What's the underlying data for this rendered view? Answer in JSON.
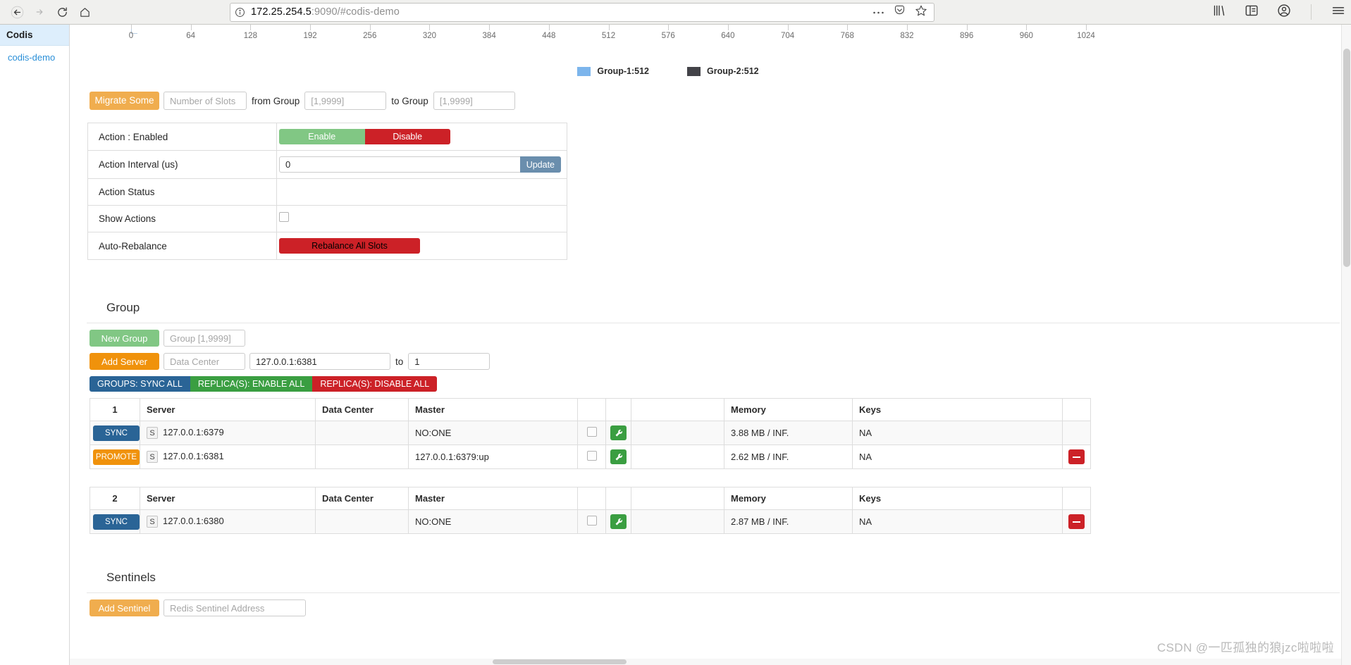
{
  "browser": {
    "back_icon": "back-arrow-icon",
    "forward_icon": "forward-arrow-icon",
    "reload_icon": "reload-icon",
    "home_icon": "home-icon",
    "info_icon": "page-info-icon",
    "url_host": "172.25.254.5",
    "url_rest": ":9090/#codis-demo",
    "url_full": "172.25.254.5:9090/#codis-demo",
    "more_icon": "ellipsis-icon",
    "pocket_icon": "pocket-icon",
    "bookmark_icon": "star-icon",
    "library_icon": "library-icon",
    "sidebar_icon": "sidebar-toggle-icon",
    "account_icon": "account-icon",
    "menu_icon": "hamburger-menu-icon"
  },
  "sidebar": {
    "header": "Codis",
    "items": [
      {
        "label": "codis-demo"
      }
    ]
  },
  "chart_data": {
    "type": "bar",
    "title": "",
    "xlabel": "",
    "ylabel": "",
    "orientation": "horizontal-stacked",
    "xlim": [
      0,
      1024
    ],
    "tick_labels": [
      "0",
      "64",
      "128",
      "192",
      "256",
      "320",
      "384",
      "448",
      "512",
      "576",
      "640",
      "704",
      "768",
      "832",
      "896",
      "960",
      "1024"
    ],
    "tick_values": [
      0,
      64,
      128,
      192,
      256,
      320,
      384,
      448,
      512,
      576,
      640,
      704,
      768,
      832,
      896,
      960,
      1024
    ],
    "grid": false,
    "legend_position": "bottom-center",
    "series": [
      {
        "name": "Group-1:512",
        "value": 512,
        "color": "#7cb5ec"
      },
      {
        "name": "Group-2:512",
        "value": 512,
        "color": "#434348"
      }
    ]
  },
  "migrate": {
    "button_label": "Migrate Some",
    "slots_placeholder": "Number of Slots",
    "slots_value": "",
    "from_label": "from Group",
    "from_placeholder": "[1,9999]",
    "from_value": "",
    "to_label": "to Group",
    "to_placeholder": "[1,9999]",
    "to_value": ""
  },
  "action_table": {
    "rows": [
      {
        "label": "Action : Enabled",
        "type": "segmented",
        "enable_label": "Enable",
        "disable_label": "Disable"
      },
      {
        "label": "Action Interval (us)",
        "type": "input-addon",
        "value": "0",
        "addon_label": "Update"
      },
      {
        "label": "Action Status",
        "type": "empty",
        "value": ""
      },
      {
        "label": "Show Actions",
        "type": "checkbox",
        "checked": false
      },
      {
        "label": "Auto-Rebalance",
        "type": "button",
        "button_label": "Rebalance All Slots"
      }
    ]
  },
  "group_section": {
    "title": "Group",
    "new_group_label": "New Group",
    "new_group_placeholder": "Group [1,9999]",
    "new_group_value": "",
    "add_server_label": "Add Server",
    "data_center_placeholder": "Data Center",
    "data_center_value": "",
    "server_addr_placeholder": "",
    "server_addr_value": "127.0.0.1:6381",
    "to_label": "to",
    "group_id_value": "1",
    "bulk_buttons": [
      {
        "label": "GROUPS: SYNC ALL",
        "color": "#2a6496"
      },
      {
        "label": "REPLICA(S): ENABLE ALL",
        "color": "#3a9e41"
      },
      {
        "label": "REPLICA(S): DISABLE ALL",
        "color": "#cc2127"
      }
    ],
    "columns": [
      "Server",
      "Data Center",
      "Master",
      "",
      "",
      "",
      "Memory",
      "Keys",
      ""
    ],
    "groups": [
      {
        "id": "1",
        "servers": [
          {
            "action_label": "SYNC",
            "action_color": "#2a6496",
            "role_badge": "S",
            "address": "127.0.0.1:6379",
            "data_center": "",
            "master": "NO:ONE",
            "checked": false,
            "wrench_icon": "wrench-icon",
            "memory": "3.88 MB / INF.",
            "keys": "NA",
            "deletable": false
          },
          {
            "action_label": "PROMOTE",
            "action_color": "#f0920b",
            "role_badge": "S",
            "address": "127.0.0.1:6381",
            "data_center": "",
            "master": "127.0.0.1:6379:up",
            "checked": false,
            "wrench_icon": "wrench-icon",
            "memory": "2.62 MB / INF.",
            "keys": "NA",
            "deletable": true
          }
        ]
      },
      {
        "id": "2",
        "servers": [
          {
            "action_label": "SYNC",
            "action_color": "#2a6496",
            "role_badge": "S",
            "address": "127.0.0.1:6380",
            "data_center": "",
            "master": "NO:ONE",
            "checked": false,
            "wrench_icon": "wrench-icon",
            "memory": "2.87 MB / INF.",
            "keys": "NA",
            "deletable": true
          }
        ]
      }
    ]
  },
  "sentinel_section": {
    "title": "Sentinels",
    "add_label": "Add Sentinel",
    "address_placeholder": "Redis Sentinel Address",
    "address_value": ""
  },
  "watermark": "CSDN @一匹孤独的狼jzc啦啦啦"
}
